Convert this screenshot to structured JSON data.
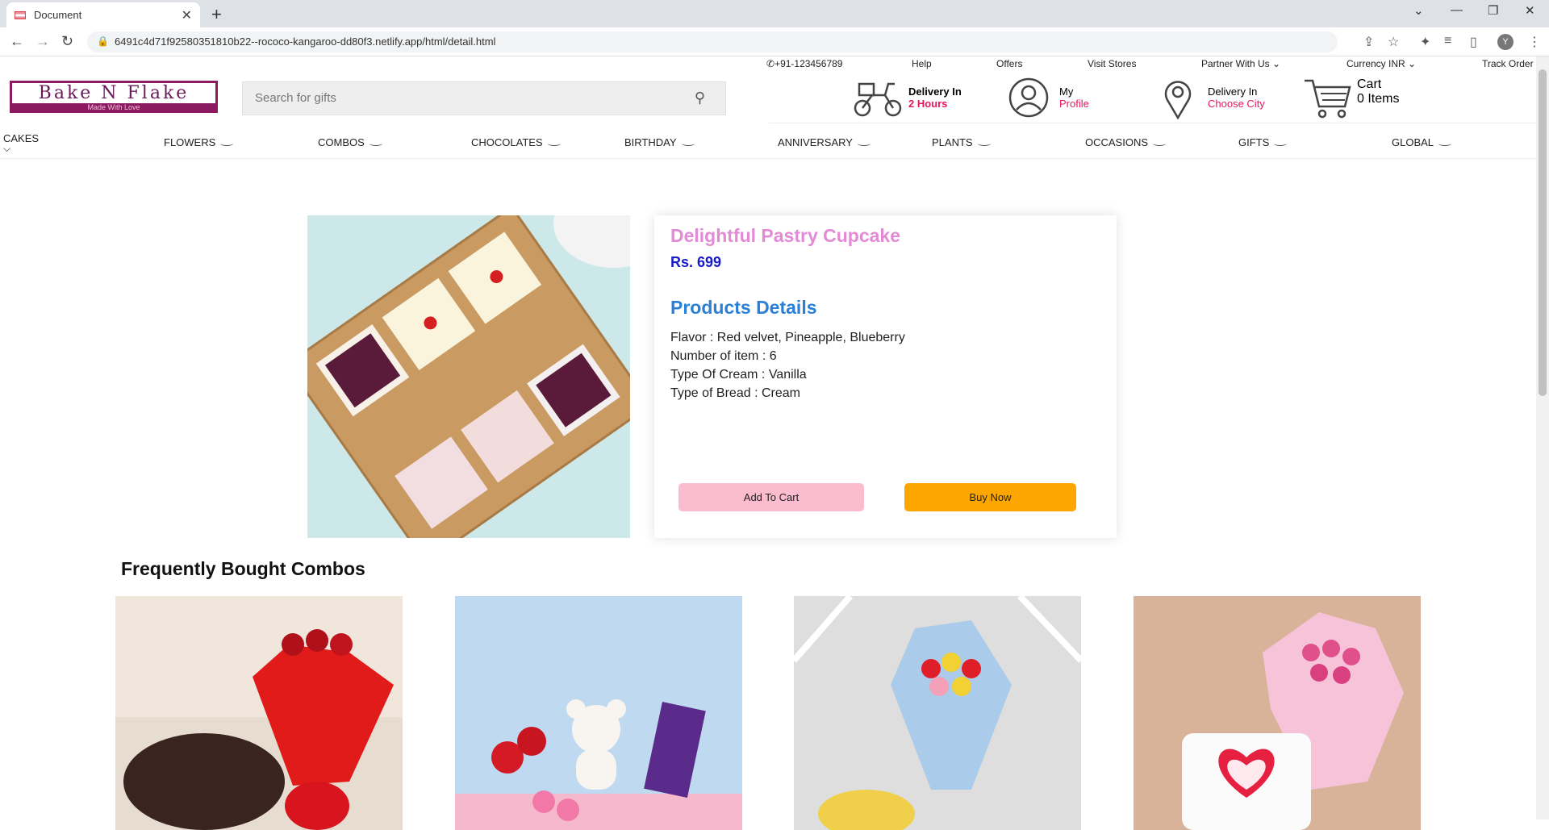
{
  "browser": {
    "tab_title": "Document",
    "url": "6491c4d71f92580351810b22--rococo-kangaroo-dd80f3.netlify.app/html/detail.html",
    "avatar_letter": "Y"
  },
  "header": {
    "logo_text": "Bake N Flake",
    "logo_tagline": "Made With Love",
    "search_placeholder": "Search for gifts",
    "phone": "+91-123456789",
    "top_links": [
      "Help",
      "Offers",
      "Visit Stores",
      "Partner With Us",
      "Currency INR",
      "Track Order"
    ],
    "delivery_title": "Delivery In",
    "delivery_value": "2 Hours",
    "profile_title": "My",
    "profile_value": "Profile",
    "city_title": "Delivery In",
    "city_value": "Choose City",
    "cart_title": "Cart",
    "cart_value": "0 Items"
  },
  "nav": {
    "items": [
      "CAKES",
      "FLOWERS",
      "COMBOS",
      "CHOCOLATES",
      "BIRTHDAY",
      "ANNIVERSARY",
      "PLANTS",
      "OCCASIONS",
      "GIFTS",
      "GLOBAL"
    ]
  },
  "product": {
    "title": "Delightful Pastry Cupcake",
    "price": "Rs. 699",
    "details_heading": "Products Details",
    "details": [
      "Flavor : Red velvet, Pineapple, Blueberry",
      "Number of item : 6",
      "Type Of Cream : Vanilla",
      "Type of Bread : Cream"
    ],
    "add_to_cart": "Add To Cart",
    "buy_now": "Buy Now"
  },
  "combos": {
    "heading": "Frequently Bought Combos"
  },
  "colors": {
    "title_pink": "#e28ad6",
    "price_blue": "#1a1acb",
    "heading_blue": "#2a7fd6",
    "cart_button": "#fbbcd0",
    "buy_button": "#fda600",
    "accent_red": "#e8175d"
  }
}
